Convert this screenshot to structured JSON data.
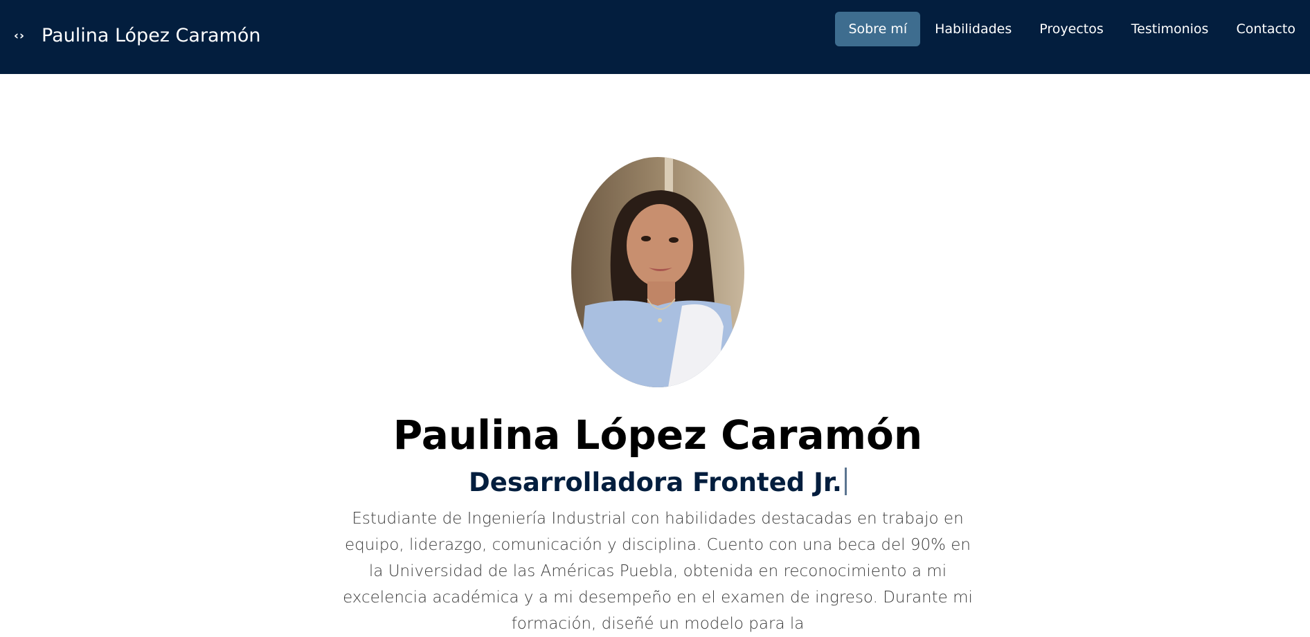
{
  "header": {
    "brand_icon": "‹›",
    "brand_icon_name": "code-icon",
    "brand_name": "Paulina López Caramón",
    "nav": [
      {
        "label": "Sobre mí",
        "active": true
      },
      {
        "label": "Habilidades",
        "active": false
      },
      {
        "label": "Proyectos",
        "active": false
      },
      {
        "label": "Testimonios",
        "active": false
      },
      {
        "label": "Contacto",
        "active": false
      }
    ]
  },
  "hero": {
    "photo_alt": "profile-photo",
    "name": "Paulina López Caramón",
    "role": "Desarrolladora Fronted Jr.",
    "bio": "Estudiante de Ingeniería Industrial con habilidades destacadas en trabajo en equipo, liderazgo, comunicación y disciplina. Cuento con una beca del 90% en la Universidad de las Américas Puebla, obtenida en reconocimiento a mi excelencia académica y a mi desempeño en el examen de ingreso. Durante mi formación, diseñé un modelo para la"
  },
  "colors": {
    "navbar_bg": "#031e3e",
    "nav_active_bg": "#3e6d8f",
    "role_text": "#031e3e"
  }
}
